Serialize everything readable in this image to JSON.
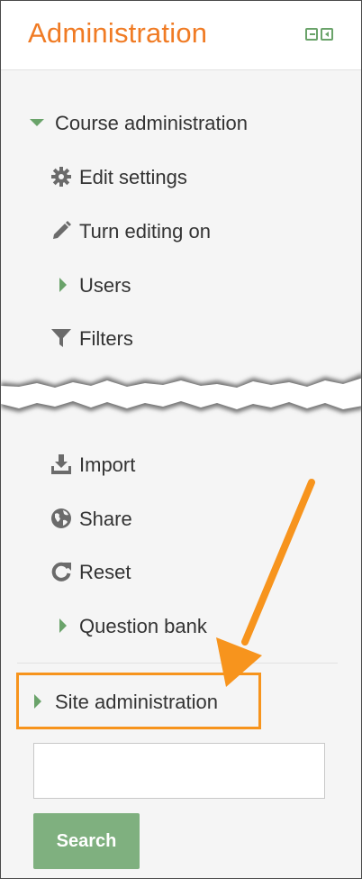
{
  "block": {
    "title": "Administration",
    "header_icons": [
      "dock-icon",
      "move-icon"
    ]
  },
  "course_admin": {
    "label": "Course administration",
    "items": [
      {
        "label": "Edit settings",
        "icon": "gear-icon"
      },
      {
        "label": "Turn editing on",
        "icon": "pencil-icon"
      },
      {
        "label": "Users",
        "icon": "expand-arrow-icon"
      },
      {
        "label": "Filters",
        "icon": "filter-icon"
      },
      {
        "label": "Import",
        "icon": "import-icon"
      },
      {
        "label": "Share",
        "icon": "globe-icon"
      },
      {
        "label": "Reset",
        "icon": "reset-icon"
      },
      {
        "label": "Question bank",
        "icon": "expand-arrow-icon"
      }
    ]
  },
  "site_admin": {
    "label": "Site administration"
  },
  "search": {
    "value": "",
    "button_label": "Search"
  },
  "colors": {
    "title": "#f07b24",
    "accent_green": "#6aa36a",
    "button_green": "#7fb07f",
    "highlight_orange": "#f7941d"
  }
}
